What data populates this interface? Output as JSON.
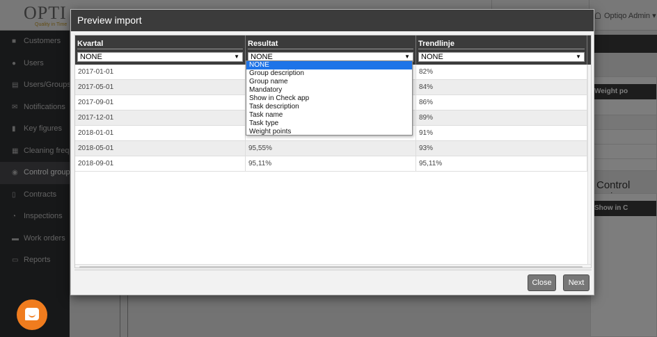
{
  "app": {
    "logo_text": "OPTI",
    "logo_tagline": "Quality in Time",
    "user_menu": "Optiqo Admin ▾"
  },
  "sidebar": {
    "items": [
      {
        "label": "Customers",
        "icon": "briefcase-icon"
      },
      {
        "label": "Users",
        "icon": "users-icon"
      },
      {
        "label": "Users/Groups",
        "icon": "id-card-icon"
      },
      {
        "label": "Notifications",
        "icon": "envelope-icon"
      },
      {
        "label": "Key figures",
        "icon": "book-icon"
      },
      {
        "label": "Cleaning frequ",
        "icon": "calculator-icon"
      },
      {
        "label": "Control groups",
        "icon": "group-icon"
      },
      {
        "label": "Contracts",
        "icon": "document-icon"
      },
      {
        "label": "Inspections",
        "icon": "clock-icon"
      },
      {
        "label": "Work orders",
        "icon": "card-icon"
      },
      {
        "label": "Reports",
        "icon": "monitor-icon"
      }
    ]
  },
  "background": {
    "weight_column": "Weight po",
    "control_tasks_title": "Control tasks",
    "show_column": "Show in C"
  },
  "modal": {
    "title": "Preview import",
    "columns": [
      {
        "title": "Kvartal",
        "mapping": "NONE"
      },
      {
        "title": "Resultat",
        "mapping": "NONE"
      },
      {
        "title": "Trendlinje",
        "mapping": "NONE"
      }
    ],
    "rows": [
      [
        "2017-01-01",
        "",
        "82%"
      ],
      [
        "2017-05-01",
        "",
        "84%"
      ],
      [
        "2017-09-01",
        "",
        "86%"
      ],
      [
        "2017-12-01",
        "",
        "89%"
      ],
      [
        "2018-01-01",
        "",
        "91%"
      ],
      [
        "2018-05-01",
        "95,55%",
        "93%"
      ],
      [
        "2018-09-01",
        "95,11%",
        "95,11%"
      ]
    ],
    "dropdown_options": [
      "NONE",
      "Group description",
      "Group name",
      "Mandatory",
      "Show in Check app",
      "Task description",
      "Task name",
      "Task type",
      "Weight points"
    ],
    "dropdown_selected": "NONE",
    "close_label": "Close",
    "next_label": "Next"
  },
  "colors": {
    "header_dark": "#3b3b3b",
    "sidebar": "#2f3033",
    "selected_option": "#1e74e8",
    "chat_launcher": "#f07c1e"
  }
}
